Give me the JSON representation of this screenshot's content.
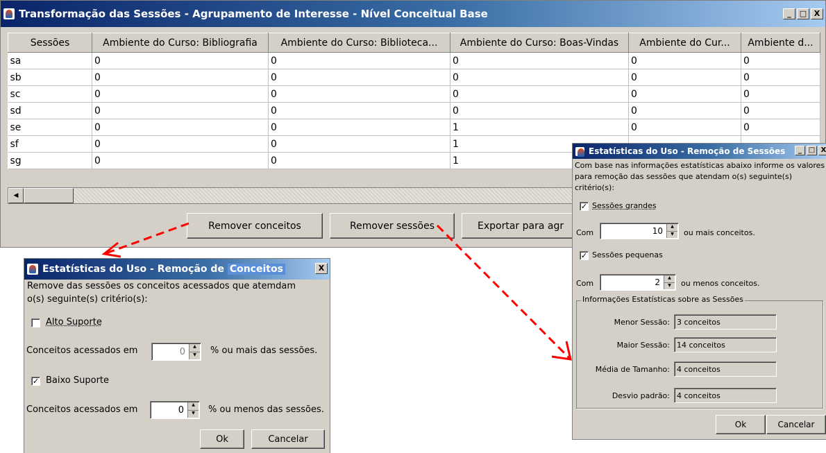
{
  "main_window": {
    "title": "Transformação das Sessões - Agrupamento de Interesse - Nível Conceitual Base",
    "title_buttons": [
      "_",
      "□",
      "X"
    ],
    "columns": [
      "Sessões",
      "Ambiente do Curso: Bibliografia",
      "Ambiente do Curso: Biblioteca...",
      "Ambiente do Curso: Boas-Vindas",
      "Ambiente do Cur...",
      "Ambiente d..."
    ],
    "rows": [
      [
        "sa",
        "0",
        "0",
        "0",
        "0",
        "0"
      ],
      [
        "sb",
        "0",
        "0",
        "0",
        "0",
        "0"
      ],
      [
        "sc",
        "0",
        "0",
        "0",
        "0",
        "0"
      ],
      [
        "sd",
        "0",
        "0",
        "0",
        "0",
        "0"
      ],
      [
        "se",
        "0",
        "0",
        "1",
        "0",
        "0"
      ],
      [
        "sf",
        "0",
        "0",
        "1",
        "",
        ""
      ],
      [
        "sg",
        "0",
        "0",
        "1",
        "",
        ""
      ]
    ],
    "buttons": {
      "remove_concepts": "Remover conceitos",
      "remove_sessions": "Remover sessões",
      "export": "Exportar para agr"
    }
  },
  "concepts_dialog": {
    "title_prefix": "Estatísticas do Uso - Remoção de ",
    "title_highlight": "Conceitos",
    "close": "X",
    "description_line1": "Remove das sessões os conceitos acessados que atemdam",
    "description_line2": "o(s) seguinte(s) critério(s):",
    "high_support": {
      "label": "Alto Suporte",
      "checked": false
    },
    "high_prefix": "Conceitos acessados em",
    "high_value": "0",
    "high_suffix": "% ou mais das sessões.",
    "low_support": {
      "label": "Baixo Suporte",
      "checked": true
    },
    "low_prefix": "Conceitos acessados em",
    "low_value": "0",
    "low_suffix": "% ou menos das sessões.",
    "ok": "Ok",
    "cancel": "Cancelar"
  },
  "sessions_dialog": {
    "title": "Estatísticas do Uso - Remoção de Sessões",
    "title_buttons": [
      "_",
      "□",
      "X"
    ],
    "description_line1": "Com base nas informações estatísticas abaixo informe os valores",
    "description_line2": "para remoção das sessões que atendam o(s) seguinte(s)",
    "description_line3": "critério(s):",
    "large": {
      "label": "Sessões grandes",
      "checked": true
    },
    "large_prefix": "Com",
    "large_value": "10",
    "large_suffix": "ou mais conceitos.",
    "small": {
      "label": "Sessões pequenas",
      "checked": true
    },
    "small_prefix": "Com",
    "small_value": "2",
    "small_suffix": "ou menos conceitos.",
    "group_title": "Informações Estatísticas sobre as Sessões",
    "stats": [
      {
        "label": "Menor Sessão:",
        "value": "3 conceitos"
      },
      {
        "label": "Maior Sessão:",
        "value": "14 conceitos"
      },
      {
        "label": "Média de Tamanho:",
        "value": "4 conceitos"
      },
      {
        "label": "Desvio padrão:",
        "value": "4 conceitos"
      }
    ],
    "ok": "Ok",
    "cancel": "Cancelar"
  },
  "colors": {
    "window_bg": "#d4d0c8",
    "title_gradient_start": "#0a246a",
    "arrow": "#ff0000"
  }
}
